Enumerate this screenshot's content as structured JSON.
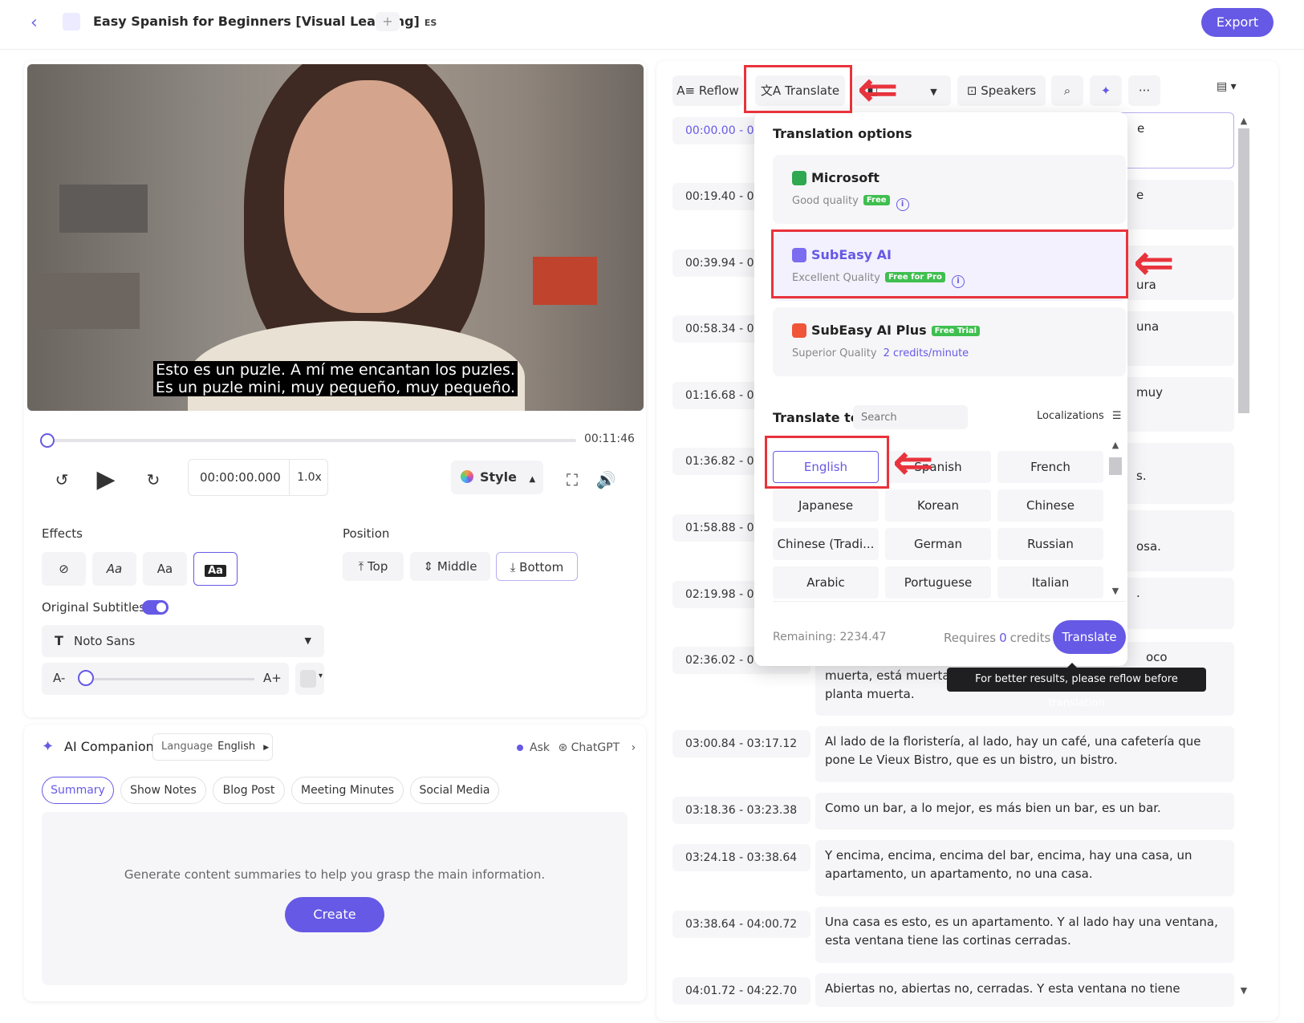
{
  "topbar": {
    "title": "Easy Spanish for Beginners [Visual Learning]",
    "lang_code": "ES",
    "add_tab": "+",
    "export_label": "Export"
  },
  "video": {
    "subtitle_line1": "Esto es un puzle. A mí me encantan los puzles.",
    "subtitle_line2": "Es un puzle mini, muy pequeño, muy pequeño.",
    "duration": "00:11:46",
    "time": "00:00:00.000",
    "speed": "1.0x",
    "style_label": "Style"
  },
  "effects": {
    "label": "Effects",
    "buttons": [
      "⊘",
      "Aa",
      "Aa",
      "Aa"
    ]
  },
  "position": {
    "label": "Position",
    "top": "⤒ Top",
    "middle": "⇕ Middle",
    "bottom": "⤓ Bottom"
  },
  "original_subtitles": {
    "label": "Original Subtitles",
    "enabled": true
  },
  "font": {
    "name": "Noto Sans",
    "a_minus": "A-",
    "a_plus": "A+"
  },
  "ai": {
    "title": "AI Companion",
    "language_label": "Language",
    "language_value": "English",
    "ask_label": "Ask",
    "ask_target": "ChatGPT",
    "tabs": [
      "Summary",
      "Show Notes",
      "Blog Post",
      "Meeting Minutes",
      "Social Media"
    ],
    "hint": "Generate content summaries to help you grasp the main information.",
    "create_label": "Create"
  },
  "toolbar": {
    "reflow": "Reflow",
    "translate": "Translate",
    "speakers": "Speakers",
    "more": "···"
  },
  "segments": [
    {
      "start": "00:00.00",
      "end": "0",
      "text": "e",
      "selected": true
    },
    {
      "start": "00:19.40",
      "end": "0",
      "text": "e"
    },
    {
      "start": "00:39.94",
      "end": "0",
      "text": "ura"
    },
    {
      "start": "00:58.34",
      "end": "0",
      "text": "una"
    },
    {
      "start": "01:16.68",
      "end": "0",
      "text": "muy"
    },
    {
      "start": "01:36.82",
      "end": "0",
      "text": "s."
    },
    {
      "start": "01:58.88",
      "end": "0",
      "text": "osa."
    },
    {
      "start": "02:19.98",
      "end": "0",
      "text": "."
    },
    {
      "start": "02:36.02",
      "end": "0",
      "text_lines": [
        "oco",
        "muerta, está muerta.",
        "planta muerta."
      ]
    },
    {
      "start": "03:00.84",
      "end": "03:17.12",
      "text": "Al lado de la floristería, al lado, hay un café, una cafetería que pone Le Vieux Bistro, que es un bistro, un bistro."
    },
    {
      "start": "03:18.36",
      "end": "03:23.38",
      "text": "Como un bar, a lo mejor, es más bien un bar, es un bar."
    },
    {
      "start": "03:24.18",
      "end": "03:38.64",
      "text": "Y encima, encima, encima del bar, encima, hay una casa, un apartamento, un apartamento, no una casa."
    },
    {
      "start": "03:38.64",
      "end": "04:00.72",
      "text": "Una casa es esto, es un apartamento. Y al lado hay una ventana, esta ventana tiene las cortinas cerradas."
    },
    {
      "start": "04:01.72",
      "end": "04:22.70",
      "text": "Abiertas no, abiertas no, cerradas. Y esta ventana no tiene"
    }
  ],
  "translation": {
    "title": "Translation options",
    "providers": [
      {
        "name": "Microsoft",
        "quality": "Good quality",
        "badge": "Free",
        "logo_color": "#2fa84f"
      },
      {
        "name": "SubEasy AI",
        "quality": "Excellent Quality",
        "badge": "Free for Pro",
        "logo_color": "#7c6cf0"
      },
      {
        "name": "SubEasy AI Plus",
        "quality": "Superior Quality",
        "badge": "Free Trial",
        "credits": "2 credits/minute",
        "logo_color": "#f0553a"
      }
    ],
    "translate_to_label": "Translate to",
    "search_placeholder": "Search",
    "localizations_label": "Localizations",
    "languages": [
      "English",
      "Spanish",
      "French",
      "Japanese",
      "Korean",
      "Chinese",
      "Chinese (Tradi...",
      "German",
      "Russian",
      "Arabic",
      "Portuguese",
      "Italian"
    ],
    "selected_language": "English",
    "remaining": "Remaining: 2234.47",
    "requires_prefix": "Requires",
    "requires_credits": "0",
    "requires_suffix": "credits",
    "translate_button": "Translate",
    "tooltip": "For better results, please reflow before translation"
  },
  "accent_color": "#6659e6",
  "annotation_color": "#e8333c"
}
